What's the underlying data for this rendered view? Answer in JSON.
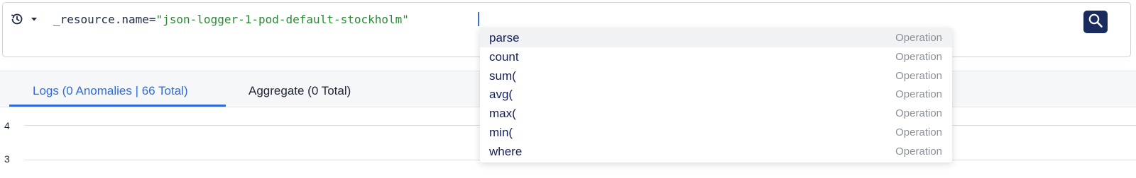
{
  "query": {
    "field": "_resource.name=",
    "value": "\"json-logger-1-pod-default-stockholm\""
  },
  "tabs": [
    {
      "label": "Logs (0 Anomalies | 66 Total)",
      "active": true
    },
    {
      "label": "Aggregate (0 Total)",
      "active": false
    }
  ],
  "chart": {
    "y_ticks": [
      "4",
      "3"
    ]
  },
  "autocomplete": {
    "items": [
      {
        "label": "parse",
        "type": "Operation"
      },
      {
        "label": "count",
        "type": "Operation"
      },
      {
        "label": "sum(",
        "type": "Operation"
      },
      {
        "label": "avg(",
        "type": "Operation"
      },
      {
        "label": "max(",
        "type": "Operation"
      },
      {
        "label": "min(",
        "type": "Operation"
      },
      {
        "label": "where",
        "type": "Operation"
      }
    ]
  },
  "colors": {
    "accent": "#2e6be0",
    "search_button": "#1a2b5e",
    "string_literal": "#2a8a34"
  },
  "icons": {
    "history": "history-icon",
    "dropdown": "caret-down-icon",
    "search": "search-icon"
  }
}
